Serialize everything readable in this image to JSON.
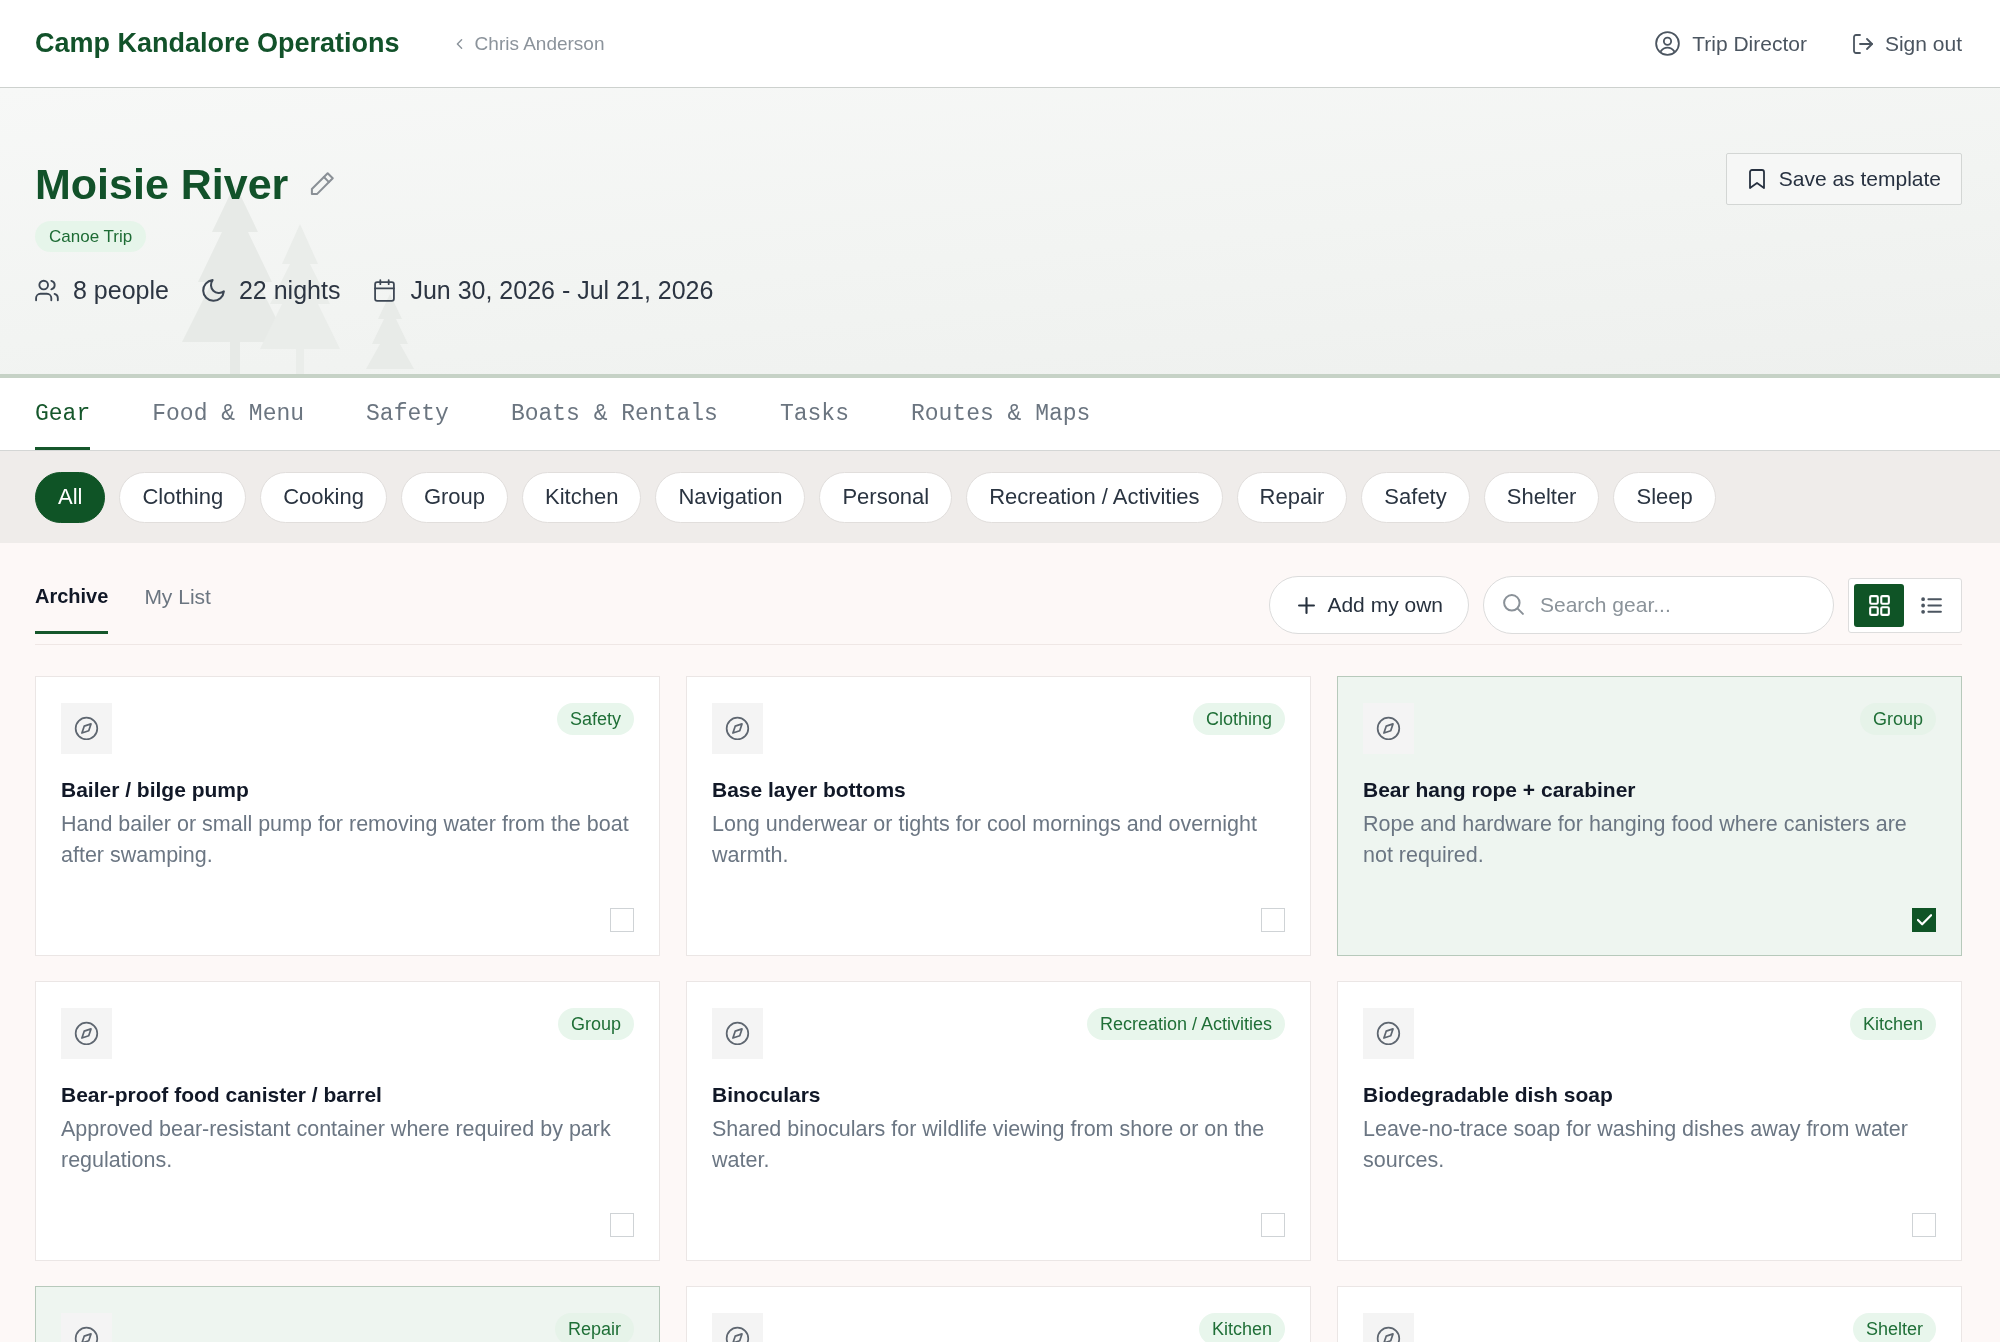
{
  "header": {
    "title": "Camp Kandalore Operations",
    "breadcrumb": "Chris Anderson",
    "role": "Trip Director",
    "sign_out": "Sign out"
  },
  "trip": {
    "name": "Moisie River",
    "type": "Canoe Trip",
    "stats": [
      {
        "kind": "people",
        "text": "8 people"
      },
      {
        "kind": "nights",
        "text": "22 nights"
      },
      {
        "kind": "dates",
        "text": "Jun 30, 2026 - Jul 21, 2026"
      }
    ],
    "save_button": "Save as template"
  },
  "tabs": [
    {
      "label": "Gear",
      "selected": true
    },
    {
      "label": "Food & Menu",
      "selected": false
    },
    {
      "label": "Safety",
      "selected": false
    },
    {
      "label": "Boats & Rentals",
      "selected": false
    },
    {
      "label": "Tasks",
      "selected": false
    },
    {
      "label": "Routes & Maps",
      "selected": false
    }
  ],
  "filters": [
    {
      "label": "All",
      "selected": true
    },
    {
      "label": "Clothing",
      "selected": false
    },
    {
      "label": "Cooking",
      "selected": false
    },
    {
      "label": "Group",
      "selected": false
    },
    {
      "label": "Kitchen",
      "selected": false
    },
    {
      "label": "Navigation",
      "selected": false
    },
    {
      "label": "Personal",
      "selected": false
    },
    {
      "label": "Recreation / Activities",
      "selected": false
    },
    {
      "label": "Repair",
      "selected": false
    },
    {
      "label": "Safety",
      "selected": false
    },
    {
      "label": "Shelter",
      "selected": false
    },
    {
      "label": "Sleep",
      "selected": false
    }
  ],
  "subtabs": [
    {
      "label": "Archive",
      "selected": true
    },
    {
      "label": "My List",
      "selected": false
    }
  ],
  "add_button": "Add my own",
  "search": {
    "placeholder": "Search gear..."
  },
  "view_toggle": [
    {
      "kind": "grid",
      "selected": true
    },
    {
      "kind": "list",
      "selected": false
    }
  ],
  "cards": [
    {
      "title": "Bailer / bilge pump",
      "description": "Hand bailer or small pump for removing water from the boat after swamping.",
      "tag": "Safety",
      "checked": false
    },
    {
      "title": "Base layer bottoms",
      "description": "Long underwear or tights for cool mornings and overnight warmth.",
      "tag": "Clothing",
      "checked": false
    },
    {
      "title": "Bear hang rope + carabiner",
      "description": "Rope and hardware for hanging food where canisters are not required.",
      "tag": "Group",
      "checked": true
    },
    {
      "title": "Bear-proof food canister / barrel",
      "description": "Approved bear-resistant container where required by park regulations.",
      "tag": "Group",
      "checked": false
    },
    {
      "title": "Binoculars",
      "description": "Shared binoculars for wildlife viewing from shore or on the water.",
      "tag": "Recreation / Activities",
      "checked": false
    },
    {
      "title": "Biodegradable dish soap",
      "description": "Leave-no-trace soap for washing dishes away from water sources.",
      "tag": "Kitchen",
      "checked": false
    },
    {
      "tag": "Repair",
      "checked": true
    },
    {
      "tag": "Kitchen",
      "checked": false
    },
    {
      "tag": "Shelter",
      "checked": false
    }
  ]
}
